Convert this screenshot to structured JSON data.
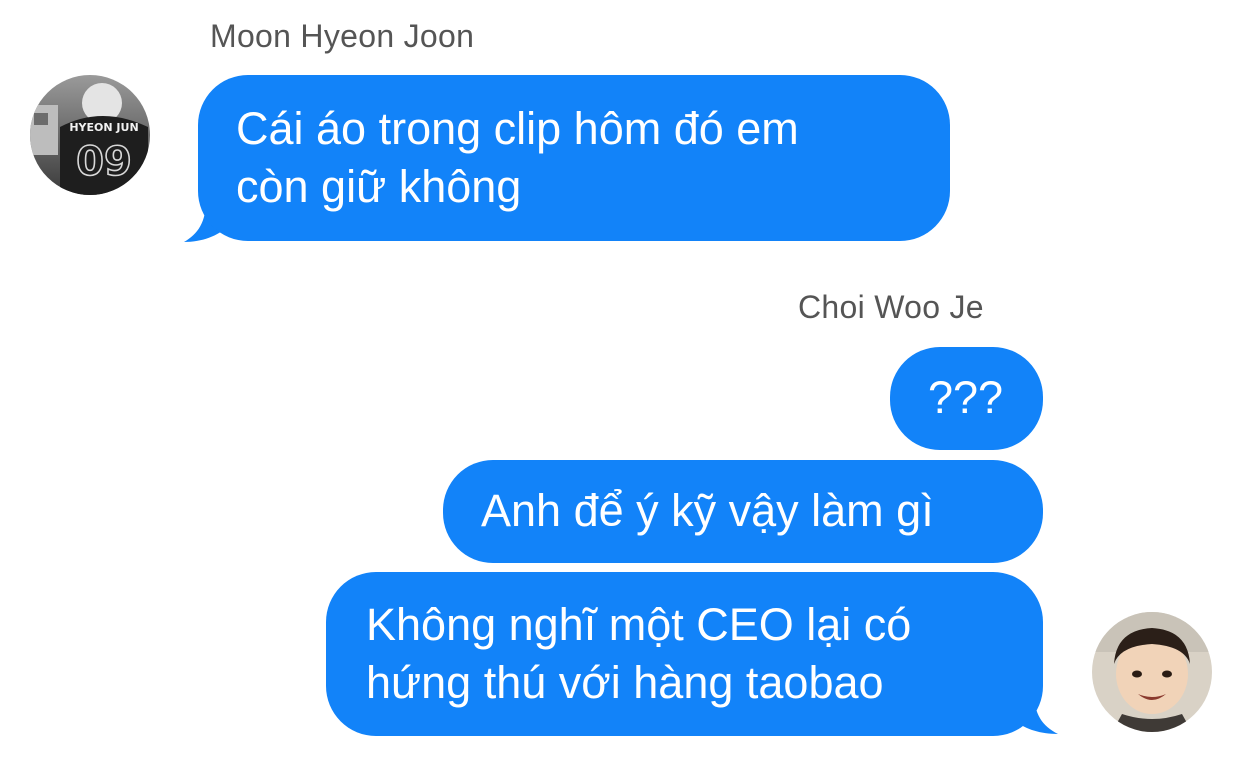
{
  "conversation": {
    "messages": [
      {
        "sender": "Moon Hyeon Joon",
        "direction": "incoming",
        "lines": [
          "Cái áo trong clip hôm đó em",
          "còn giữ không"
        ]
      },
      {
        "sender": "Choi Woo Je",
        "direction": "outgoing",
        "lines": [
          "???"
        ]
      },
      {
        "sender": "Choi Woo Je",
        "direction": "outgoing",
        "lines": [
          "Anh để ý kỹ vậy làm gì"
        ]
      },
      {
        "sender": "Choi Woo Je",
        "direction": "outgoing",
        "lines": [
          "Không nghĩ một CEO lại có",
          "hứng thú với hàng taobao"
        ]
      }
    ]
  },
  "avatars": {
    "moon": {
      "jersey_name": "HYEON JUN",
      "jersey_number": "09",
      "icon": "jersey-photo-avatar"
    },
    "choi": {
      "icon": "child-photo-avatar"
    }
  },
  "colors": {
    "bubble": "#1283f9",
    "bubble_text": "#ffffff",
    "sender_name": "#555555",
    "background": "#ffffff"
  }
}
